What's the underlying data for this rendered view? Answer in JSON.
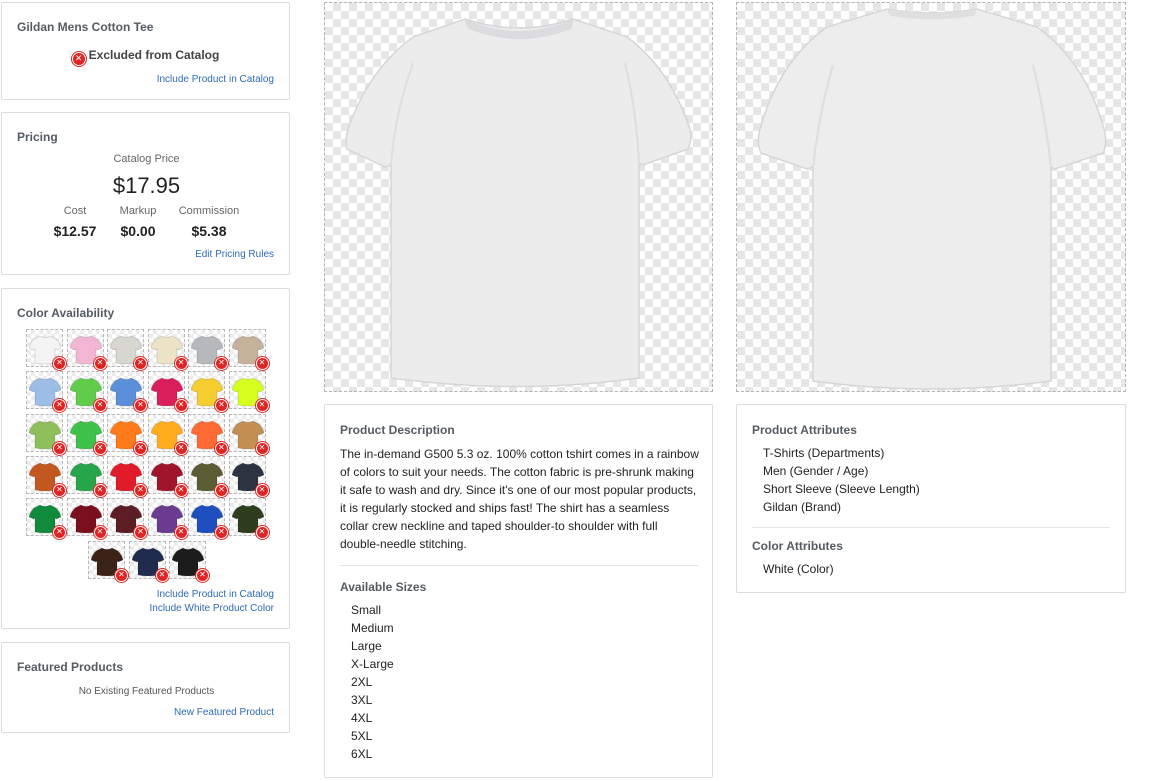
{
  "product": {
    "name": "Gildan Mens Cotton Tee",
    "catalog_status": "Excluded from Catalog",
    "include_link": "Include Product in Catalog"
  },
  "pricing": {
    "title": "Pricing",
    "catalog_price_label": "Catalog Price",
    "catalog_price": "$17.95",
    "cost_label": "Cost",
    "cost": "$12.57",
    "markup_label": "Markup",
    "markup": "$0.00",
    "commission_label": "Commission",
    "commission": "$5.38",
    "edit_link": "Edit Pricing Rules"
  },
  "colors": {
    "title": "Color Availability",
    "swatches": [
      "#f4f4f4",
      "#f2b6d4",
      "#d7d7d0",
      "#ece2c6",
      "#b6b8bb",
      "#c5b29b",
      "#9bbde6",
      "#5fcd4a",
      "#5b8fd9",
      "#d81e5b",
      "#f5cd2e",
      "#d6ff1f",
      "#8fbf5a",
      "#3ec24a",
      "#ff7a1a",
      "#ffad1f",
      "#ff6a35",
      "#c48f52",
      "#c2571f",
      "#26a54a",
      "#e01c2a",
      "#a0152a",
      "#5a5d33",
      "#2b3440",
      "#128a3c",
      "#7a0f1e",
      "#5c1d25",
      "#6a3c8f",
      "#1e4fbf",
      "#2d3d1e",
      "#3b2318",
      "#1f2c4d",
      "#1c1c1c"
    ],
    "include_catalog_link": "Include Product in Catalog",
    "include_white_link": "Include White Product Color",
    "status_icon": "close-circle-icon"
  },
  "featured": {
    "title": "Featured Products",
    "empty_text": "No Existing Featured Products",
    "new_link": "New Featured Product"
  },
  "description": {
    "title": "Product Description",
    "lines": [
      "The in-demand G500 5.3 oz. 100% cotton tshirt comes in a rainbow",
      "of colors to suit your needs. The cotton fabric is pre-shrunk making",
      "it safe to wash and dry. Since it's one of our most popular products,",
      "it is regularly stocked and ships fast! The shirt has a seamless",
      "collar crew neckline and taped shoulder-to shoulder with full",
      "double-needle stitching."
    ],
    "sizes_title": "Available Sizes",
    "sizes": [
      "Small",
      "Medium",
      "Large",
      "X-Large",
      "2XL",
      "3XL",
      "4XL",
      "5XL",
      "6XL"
    ]
  },
  "attributes": {
    "title": "Product Attributes",
    "items": [
      "T-Shirts (Departments)",
      "Men (Gender / Age)",
      "Short Sleeve (Sleeve Length)",
      "Gildan (Brand)"
    ],
    "color_title": "Color Attributes",
    "color_items": [
      "White (Color)"
    ]
  }
}
